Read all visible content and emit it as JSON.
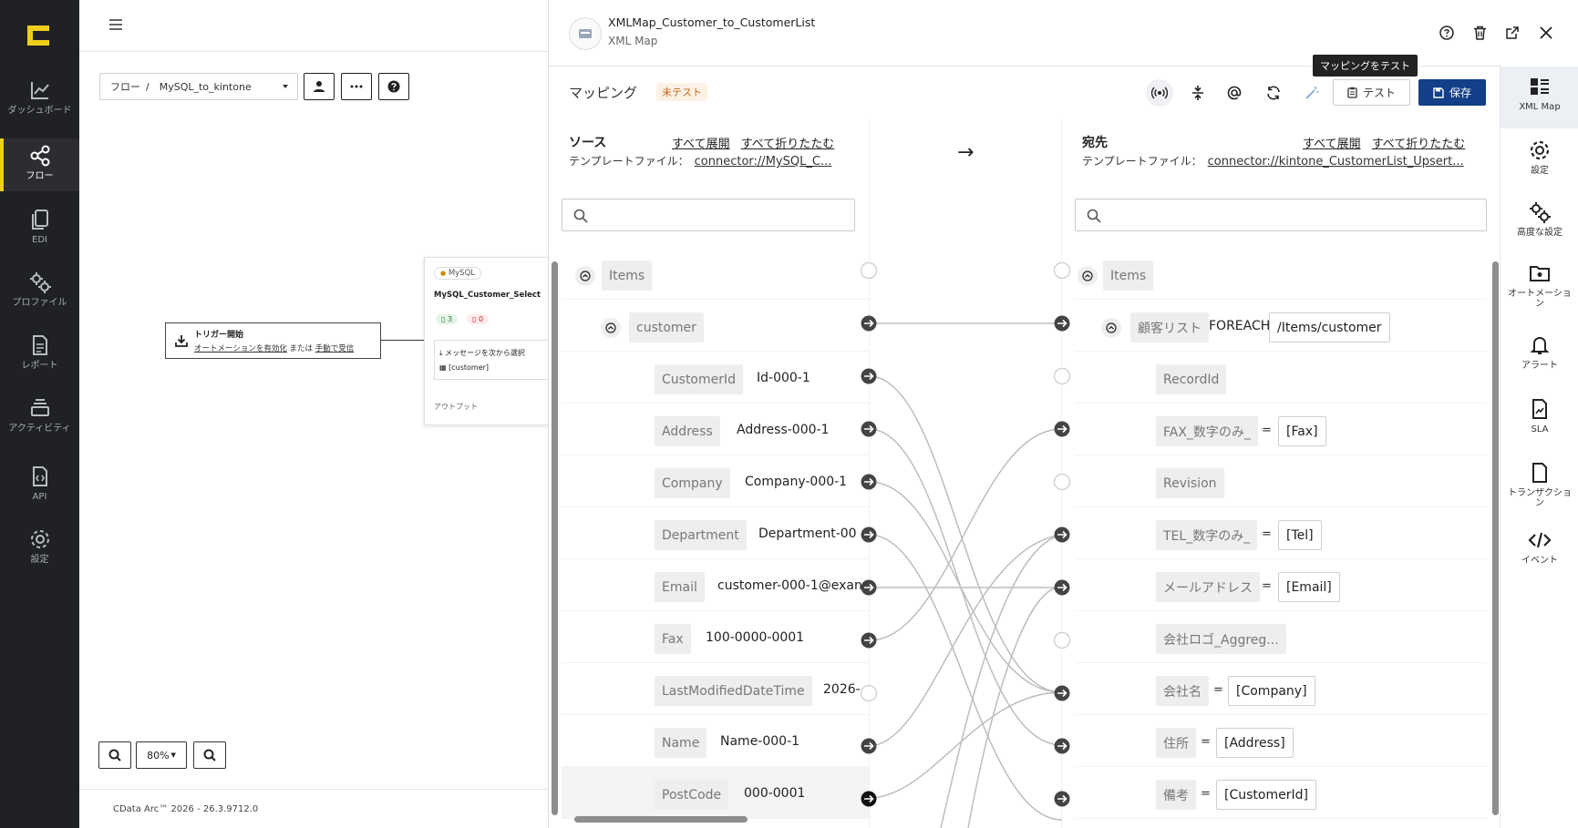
{
  "nav": {
    "items": [
      {
        "label": "ダッシュボード",
        "icon": "chart-line-icon"
      },
      {
        "label": "フロー",
        "icon": "share-nodes-icon",
        "active": true
      },
      {
        "label": "EDI",
        "icon": "documents-icon"
      },
      {
        "label": "プロファイル",
        "icon": "gears-icon"
      },
      {
        "label": "レポート",
        "icon": "report-icon"
      },
      {
        "label": "アクティビティ",
        "icon": "stack-icon"
      },
      {
        "label": "API",
        "icon": "api-icon"
      },
      {
        "label": "設定",
        "icon": "gear-icon"
      }
    ]
  },
  "canvas": {
    "breadcrumb_root": "フロー",
    "breadcrumb_sep": "/",
    "breadcrumb_current": "MySQL_to_kintone",
    "trigger_title": "トリガー開始",
    "trigger_link1": "オートメーションを有効化",
    "trigger_or": "または",
    "trigger_link2": "手動で受信",
    "mysql_chip": "MySQL",
    "mysql_name": "MySQL_Customer_Select",
    "mysql_badge_success": "3",
    "mysql_badge_error": "0",
    "mysql_msg": "メッセージを次から選択",
    "mysql_table": "[customer]",
    "mysql_output": "アウトプット",
    "zoom": "80%",
    "footer": "CData Arc™ 2026 - 26.3.9712.0"
  },
  "panel": {
    "title": "XMLMap_Customer_to_CustomerList",
    "subtitle": "XML Map",
    "mapping_label": "マッピング",
    "status_badge": "未テスト",
    "test_label": "テスト",
    "save_label": "保存",
    "tooltip": "マッピングをテスト",
    "arrow": "→",
    "source": {
      "title": "ソース",
      "expand_all": "すべて展開",
      "collapse_all": "すべて折りたたむ",
      "template_label": "テンプレートファイル：",
      "template_value": "connector://MySQL_C..."
    },
    "dest": {
      "title": "宛先",
      "expand_all": "すべて展開",
      "collapse_all": "すべて折りたたむ",
      "template_label": "テンプレートファイル：",
      "template_value": "connector://kintone_CustomerList_Upsert..."
    },
    "source_rows": [
      {
        "tag": "Items",
        "value": ""
      },
      {
        "tag": "customer",
        "value": ""
      },
      {
        "tag": "CustomerId",
        "value": "Id-000-1"
      },
      {
        "tag": "Address",
        "value": "Address-000-1"
      },
      {
        "tag": "Company",
        "value": "Company-000-1"
      },
      {
        "tag": "Department",
        "value": "Department-00"
      },
      {
        "tag": "Email",
        "value": "customer-000-1@exan"
      },
      {
        "tag": "Fax",
        "value": "100-0000-0001"
      },
      {
        "tag": "LastModifiedDateTime",
        "value": "2026-"
      },
      {
        "tag": "Name",
        "value": "Name-000-1"
      },
      {
        "tag": "PostCode",
        "value": "000-0001"
      }
    ],
    "dest_rows": [
      {
        "tag": "Items",
        "expr": ""
      },
      {
        "tag": "顧客リスト",
        "foreach": "FOREACH",
        "expr": "/Items/customer"
      },
      {
        "tag": "RecordId",
        "expr": ""
      },
      {
        "tag": "FAX_数字のみ_",
        "eq": "=",
        "expr": "[Fax]"
      },
      {
        "tag": "Revision",
        "expr": ""
      },
      {
        "tag": "TEL_数字のみ_",
        "eq": "=",
        "expr": "[Tel]"
      },
      {
        "tag": "メールアドレス",
        "eq": "=",
        "expr": "[Email]"
      },
      {
        "tag": "会社ロゴ_Aggreg...",
        "expr": ""
      },
      {
        "tag": "会社名",
        "eq": "=",
        "expr": "[Company]"
      },
      {
        "tag": "住所",
        "eq": "=",
        "expr": "[Address]"
      },
      {
        "tag": "備考",
        "eq": "=",
        "expr": "[CustomerId]"
      }
    ]
  },
  "rail": {
    "items": [
      {
        "label": "XML Map",
        "icon": "grid-list-icon",
        "active": true
      },
      {
        "label": "設定",
        "icon": "gear-icon"
      },
      {
        "label": "高度な設定",
        "icon": "gears-icon"
      },
      {
        "label": "オートメーション",
        "icon": "folder-gear-icon"
      },
      {
        "label": "アラート",
        "icon": "bell-icon"
      },
      {
        "label": "SLA",
        "icon": "sla-icon"
      },
      {
        "label": "トランザクション",
        "icon": "file-icon"
      },
      {
        "label": "イベント",
        "icon": "code-icon"
      }
    ]
  }
}
